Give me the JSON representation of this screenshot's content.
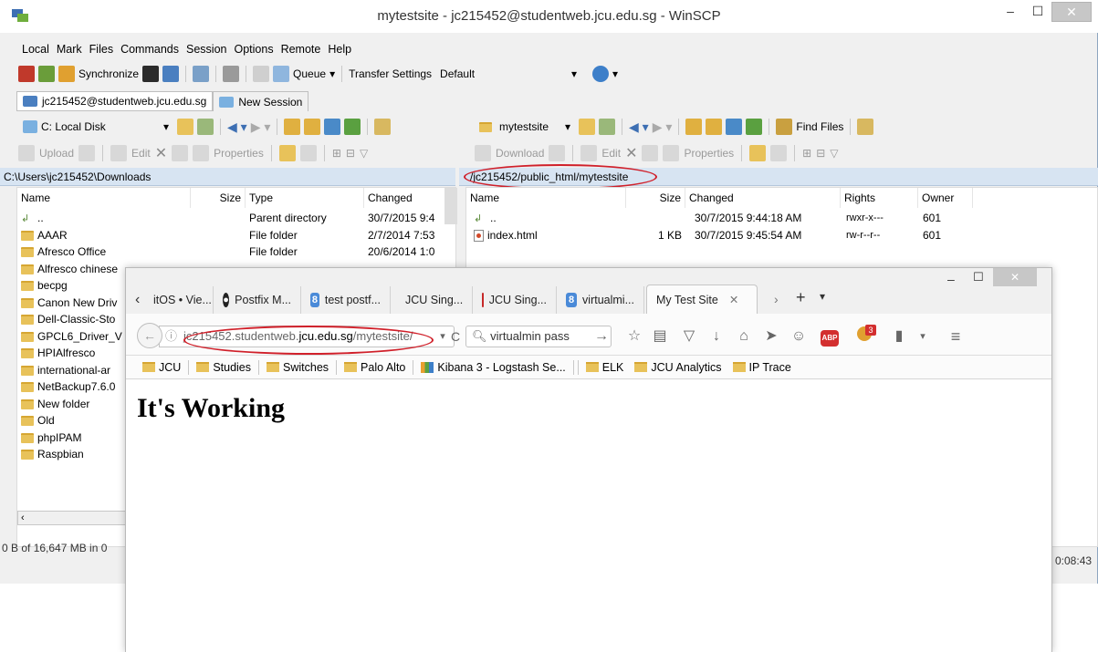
{
  "winscp": {
    "title": "mytestsite - jc215452@studentweb.jcu.edu.sg - WinSCP",
    "menu": [
      "Local",
      "Mark",
      "Files",
      "Commands",
      "Session",
      "Options",
      "Remote",
      "Help"
    ],
    "toolbar": {
      "synchronize": "Synchronize",
      "queue": "Queue",
      "transfer_settings_label": "Transfer Settings",
      "transfer_settings_value": "Default"
    },
    "tabs": [
      "jc215452@studentweb.jcu.edu.sg",
      "New Session"
    ],
    "local": {
      "drive": "C: Local Disk",
      "actions": [
        "Upload",
        "Edit",
        "Properties"
      ],
      "path": "C:\\Users\\jc215452\\Downloads",
      "columns": [
        "Name",
        "Size",
        "Type",
        "Changed"
      ],
      "rows": [
        {
          "name": "..",
          "size": "",
          "type": "Parent directory",
          "changed": "30/7/2015 9:4",
          "icon": "up"
        },
        {
          "name": "AAAR",
          "size": "",
          "type": "File folder",
          "changed": "2/7/2014 7:53",
          "icon": "folder"
        },
        {
          "name": "Afresco Office",
          "size": "",
          "type": "File folder",
          "changed": "20/6/2014 1:0",
          "icon": "folder"
        },
        {
          "name": "Alfresco chinese",
          "size": "",
          "type": "",
          "changed": "",
          "icon": "folder"
        },
        {
          "name": "becpg",
          "size": "",
          "type": "",
          "changed": "",
          "icon": "folder"
        },
        {
          "name": "Canon New Driv",
          "size": "",
          "type": "",
          "changed": "",
          "icon": "folder"
        },
        {
          "name": "Dell-Classic-Sto",
          "size": "",
          "type": "",
          "changed": "",
          "icon": "folder"
        },
        {
          "name": "GPCL6_Driver_V",
          "size": "",
          "type": "",
          "changed": "",
          "icon": "folder"
        },
        {
          "name": "HPIAlfresco",
          "size": "",
          "type": "",
          "changed": "",
          "icon": "folder"
        },
        {
          "name": "international-ar",
          "size": "",
          "type": "",
          "changed": "",
          "icon": "folder"
        },
        {
          "name": "NetBackup7.6.0",
          "size": "",
          "type": "",
          "changed": "",
          "icon": "folder"
        },
        {
          "name": "New folder",
          "size": "",
          "type": "",
          "changed": "",
          "icon": "folder"
        },
        {
          "name": "Old",
          "size": "",
          "type": "",
          "changed": "",
          "icon": "folder"
        },
        {
          "name": "phpIPAM",
          "size": "",
          "type": "",
          "changed": "",
          "icon": "folder"
        },
        {
          "name": "Raspbian",
          "size": "",
          "type": "",
          "changed": "",
          "icon": "folder"
        }
      ]
    },
    "remote": {
      "folder": "mytestsite",
      "find_files": "Find Files",
      "actions": [
        "Download",
        "Edit",
        "Properties"
      ],
      "path": "/jc215452/public_html/mytestsite",
      "columns": [
        "Name",
        "Size",
        "Changed",
        "Rights",
        "Owner"
      ],
      "rows": [
        {
          "name": "..",
          "size": "",
          "changed": "30/7/2015 9:44:18 AM",
          "rights": "rwxr-x---",
          "owner": "601",
          "icon": "up"
        },
        {
          "name": "index.html",
          "size": "1 KB",
          "changed": "30/7/2015 9:45:54 AM",
          "rights": "rw-r--r--",
          "owner": "601",
          "icon": "html"
        }
      ]
    },
    "status_left": "0 B of 16,647 MB in 0",
    "status_right": "0:08:43"
  },
  "firefox": {
    "tabs": [
      {
        "label": "itOS • Vie...",
        "icon": "none"
      },
      {
        "label": "Postfix M...",
        "icon": "github"
      },
      {
        "label": "test postf...",
        "icon": "google"
      },
      {
        "label": "JCU Sing...",
        "icon": "jcu"
      },
      {
        "label": "JCU Sing...",
        "icon": "jcu"
      },
      {
        "label": "virtualmi...",
        "icon": "google"
      },
      {
        "label": "My Test Site",
        "icon": "none"
      }
    ],
    "url_host": "jc215452.studentweb.",
    "url_domain": "jcu.edu.sg",
    "url_path": "/mytestsite/",
    "search_text": "virtualmin pass",
    "badge_count": "3",
    "bookmarks": [
      "JCU",
      "Studies",
      "Switches",
      "Palo Alto",
      "Kibana 3 - Logstash Se...",
      "ELK",
      "JCU Analytics",
      "IP Trace"
    ],
    "page_heading": "It's Working"
  }
}
